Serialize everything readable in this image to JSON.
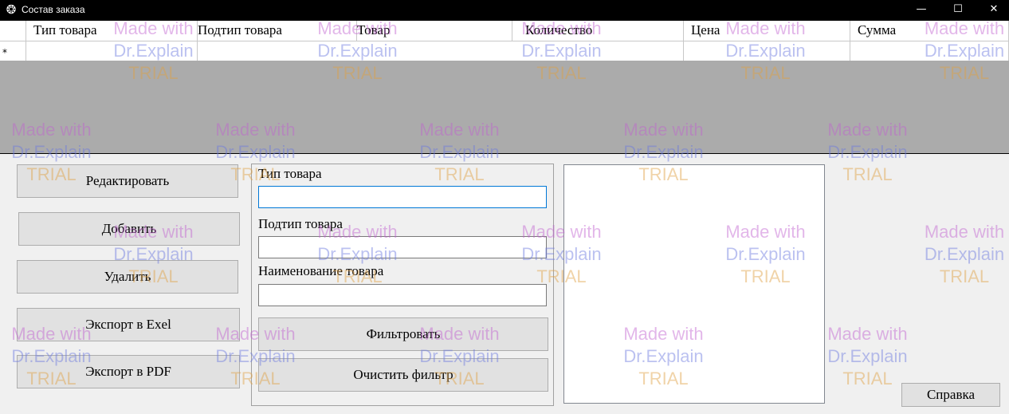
{
  "window": {
    "title": "Состав заказа",
    "app_icon": "app-gear-icon",
    "minimize_glyph": "—",
    "maximize_glyph": "☐",
    "close_glyph": "✕"
  },
  "grid": {
    "columns": [
      "Тип товара",
      "Подтип товара",
      "Товар",
      "Количество",
      "Цена",
      "Сумма"
    ],
    "new_row_marker": "*"
  },
  "actions": {
    "edit": "Редактировать",
    "add": "Добавить",
    "delete": "Удалить",
    "export_excel": "Экспорт в Exel",
    "export_pdf": "Экспорт в PDF"
  },
  "filter": {
    "type_label": "Тип товара",
    "type_value": "",
    "subtype_label": "Подтип товара",
    "subtype_value": "",
    "name_label": "Наименование товара",
    "name_value": "",
    "apply_button": "Фильтровать",
    "clear_button": "Очистить фильтр"
  },
  "help_button": "Справка",
  "watermark": {
    "line1": "Made with",
    "line2": "Dr.Explain",
    "line3": "TRIAL"
  }
}
